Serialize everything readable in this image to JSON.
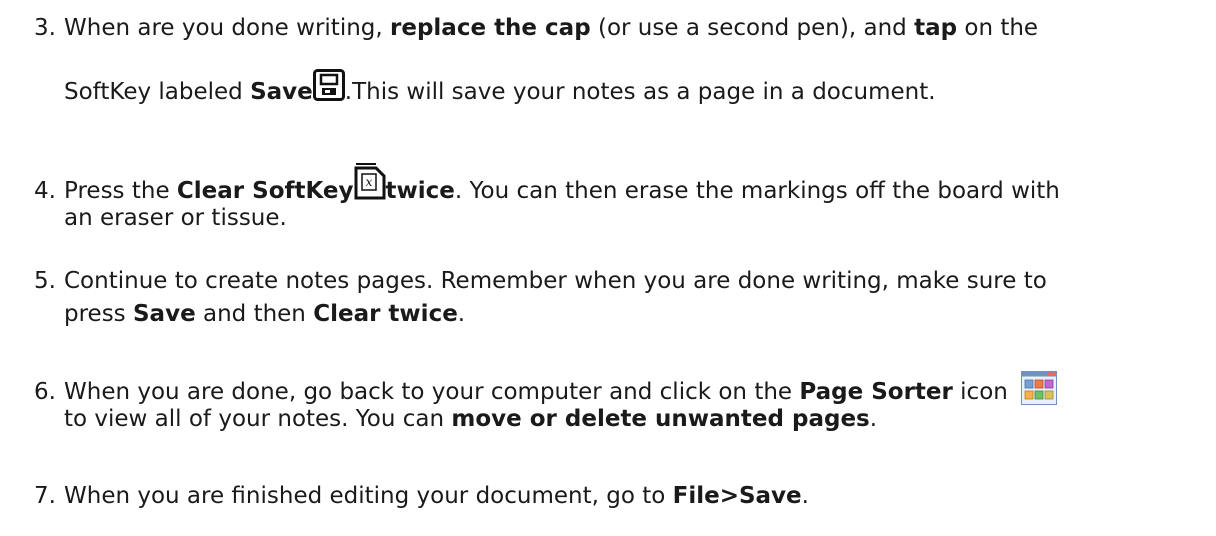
{
  "steps": [
    {
      "number": "3.",
      "line1_a": "When are you done writing, ",
      "line1_b": "replace the cap",
      "line1_c": " (or use a second pen), and ",
      "line1_d": "tap",
      "line1_e": " on the",
      "line2_a": "SoftKey labeled ",
      "line2_b": "Save",
      "line2_c": ".This will save your notes as a page in a document.",
      "icon": "save-softkey-icon"
    },
    {
      "number": "4.",
      "line1_a": "Press the ",
      "line1_b": "Clear SoftKey",
      "line1_c": "twice",
      "line1_d": ". You can then erase the markings off the board with",
      "line2_a": "an eraser or tissue.",
      "icon": "clear-softkey-icon"
    },
    {
      "number": "5.",
      "line1_a": "Continue to create notes pages. Remember when you are done writing, make sure to",
      "line2_a": "press ",
      "line2_b": "Save",
      "line2_c": " and then ",
      "line2_d": "Clear twice",
      "line2_e": "."
    },
    {
      "number": "6.",
      "line1_a": "When you are done, go back to your computer and click on the ",
      "line1_b": "Page Sorter",
      "line1_c": " icon",
      "line2_a": "to view all of your notes. You can ",
      "line2_b": "move or delete unwanted pages",
      "line2_c": ".",
      "icon": "page-sorter-icon"
    },
    {
      "number": "7.",
      "line1_a": "When you are finished editing your document, go to ",
      "line1_b": "File>Save",
      "line1_c": "."
    }
  ]
}
